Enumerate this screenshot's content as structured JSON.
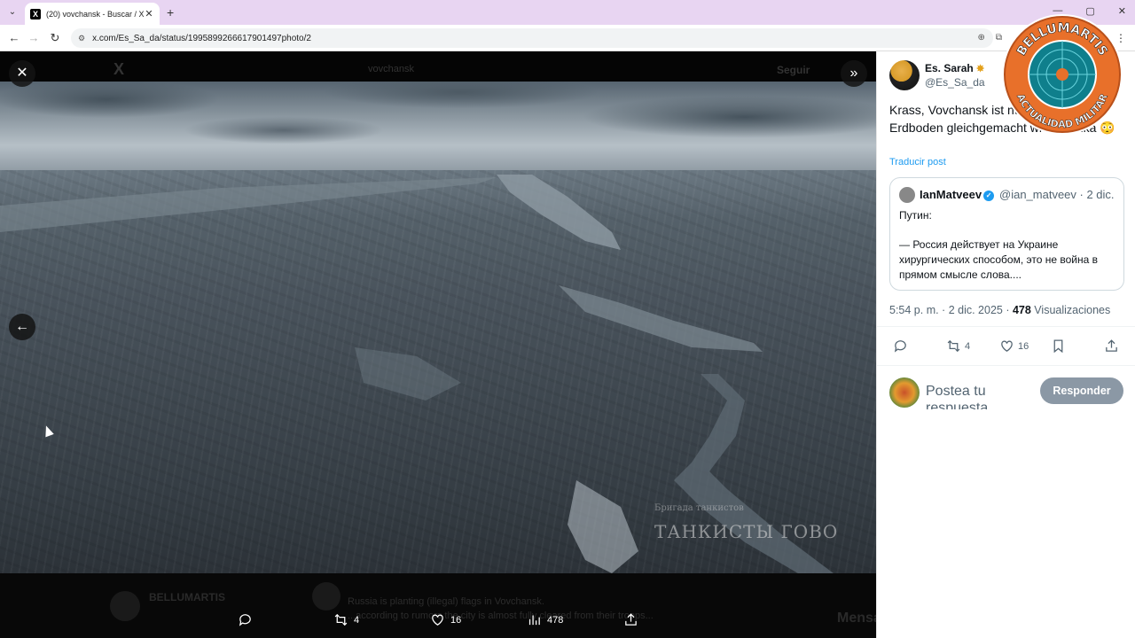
{
  "browser": {
    "tab_title": "(20) vovchansk - Buscar / X",
    "url": "x.com/Es_Sa_da/status/1995899266617901497photo/2",
    "tab_close": "✕",
    "new_tab": "+",
    "win_min": "—",
    "win_max": "▢",
    "win_close": "✕"
  },
  "viewer": {
    "ghost_search": "vovchansk",
    "ghost_follow": "Seguir",
    "ghost_bottom_name": "BELLUMARTIS",
    "ghost_line1": "Russia is planting (illegal) flags in Vovchansk.",
    "ghost_line2": "...according to rumors the city is almost fully cleared from their troops...",
    "ghost_messages": "Mensajes",
    "watermark_small": "Бригада танкистов",
    "watermark": "ТАНКИСТЫ ГОВО",
    "actions": {
      "retweets": "4",
      "likes": "16",
      "views": "478"
    }
  },
  "post": {
    "author_name": "Es. Sarah",
    "author_handle": "@Es_Sa_da",
    "text": "Krass, Vovchansk ist nun genauso dem Erdboden gleichgemacht wie Marinka 😳",
    "translate": "Traducir post",
    "quote": {
      "name": "IanMatveev",
      "handle": "@ian_matveev · 2 dic.",
      "line1": "Путин:",
      "line2": "— Россия действует на Украине",
      "line3": "хирургических способом, это не война в",
      "line4": "прямом смысле слова...."
    },
    "time": "5:54 p. m. · 2 dic. 2025 · ",
    "views_count": "478",
    "views_label": " Visualizaciones",
    "retweets": "4",
    "likes": "16",
    "reply_placeholder": "Postea tu respuesta",
    "reply_button": "Responder"
  },
  "brand": {
    "top": "BELLUMARTIS",
    "bottom": "ACTUALIDAD MILITAR"
  },
  "colors": {
    "accent": "#1d9bf0",
    "tabbar": "#e8d5f2",
    "logo_orange": "#e8702a"
  }
}
